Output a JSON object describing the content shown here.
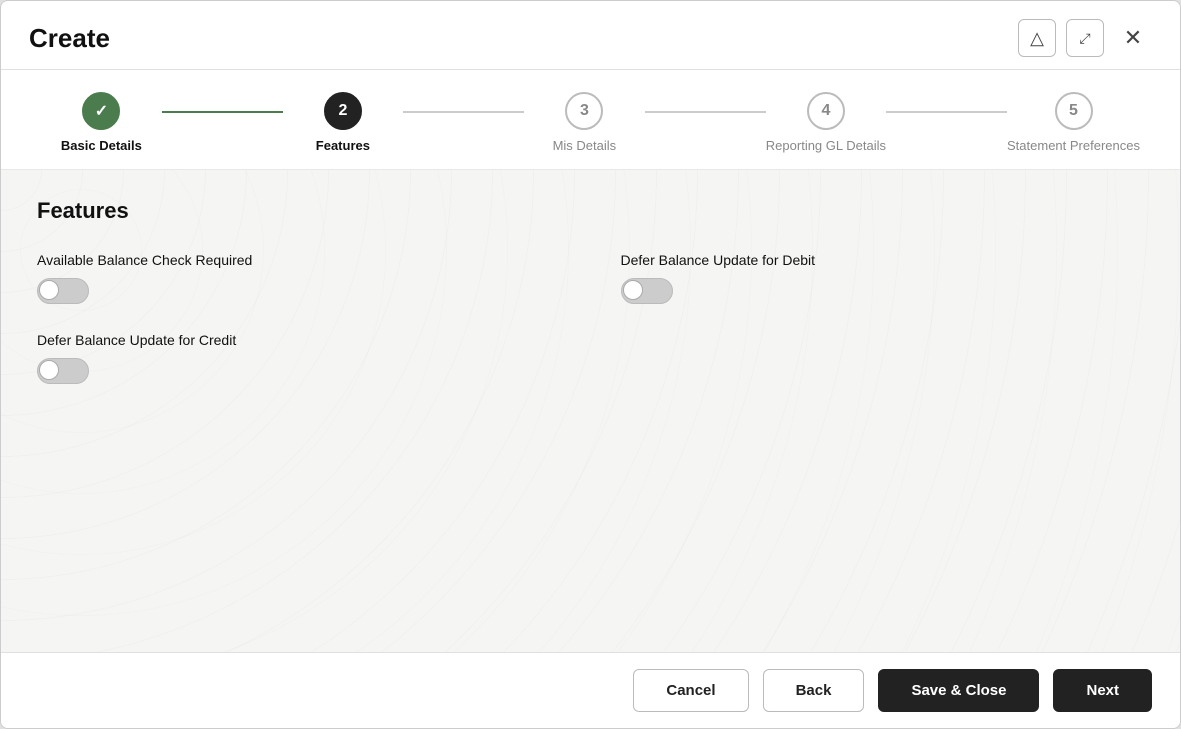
{
  "modal": {
    "title": "Create"
  },
  "header": {
    "alert_icon": "⚠",
    "expand_icon": "⛶",
    "close_icon": "✕"
  },
  "stepper": {
    "steps": [
      {
        "id": 1,
        "label": "Basic Details",
        "state": "done",
        "display": "✓"
      },
      {
        "id": 2,
        "label": "Features",
        "state": "active",
        "display": "2"
      },
      {
        "id": 3,
        "label": "Mis Details",
        "state": "inactive",
        "display": "3"
      },
      {
        "id": 4,
        "label": "Reporting GL Details",
        "state": "inactive",
        "display": "4"
      },
      {
        "id": 5,
        "label": "Statement Preferences",
        "state": "inactive",
        "display": "5"
      }
    ]
  },
  "features": {
    "section_title": "Features",
    "items": [
      {
        "id": "avail-balance",
        "label": "Available Balance Check Required",
        "enabled": false
      },
      {
        "id": "defer-debit",
        "label": "Defer Balance Update for Debit",
        "enabled": false
      },
      {
        "id": "defer-credit",
        "label": "Defer Balance Update for Credit",
        "enabled": false
      }
    ]
  },
  "footer": {
    "cancel_label": "Cancel",
    "back_label": "Back",
    "save_close_label": "Save & Close",
    "next_label": "Next"
  }
}
